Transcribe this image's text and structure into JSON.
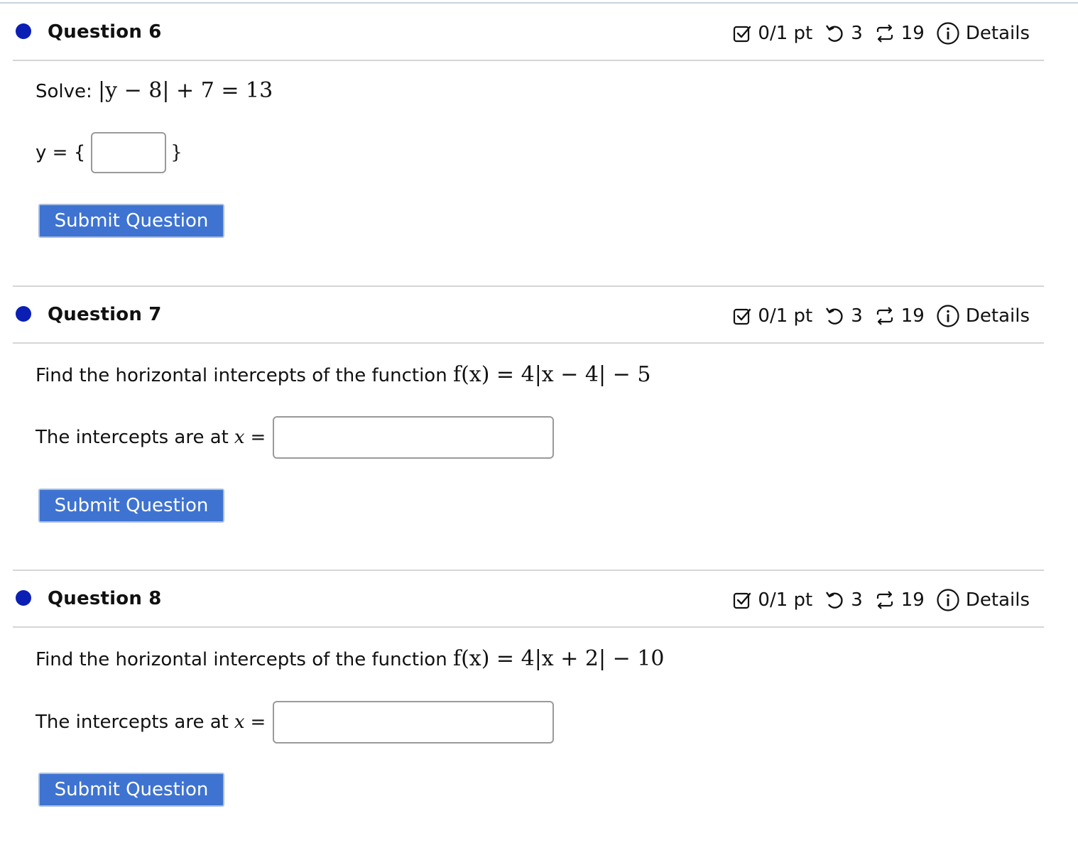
{
  "questions": [
    {
      "title": "Question 6",
      "score": "0/1 pt",
      "retries": "3",
      "attempts": "19",
      "details_label": "Details",
      "prompt_label": "Solve:",
      "prompt_math": "|y − 8| + 7 = 13",
      "answer_prefix": "y = {",
      "answer_suffix": "}",
      "answer_value": "",
      "submit_label": "Submit Question"
    },
    {
      "title": "Question 7",
      "score": "0/1 pt",
      "retries": "3",
      "attempts": "19",
      "details_label": "Details",
      "prompt_label": "Find the horizontal intercepts of the function",
      "prompt_math": "f(x) = 4|x − 4| − 5",
      "answer_prefix": "The intercepts are at",
      "answer_var": "x",
      "answer_eq": "=",
      "answer_value": "",
      "submit_label": "Submit Question"
    },
    {
      "title": "Question 8",
      "score": "0/1 pt",
      "retries": "3",
      "attempts": "19",
      "details_label": "Details",
      "prompt_label": "Find the horizontal intercepts of the function",
      "prompt_math": "f(x) = 4|x + 2| − 10",
      "answer_prefix": "The intercepts are at",
      "answer_var": "x",
      "answer_eq": "=",
      "answer_value": "",
      "submit_label": "Submit Question"
    }
  ],
  "colors": {
    "status_dot": "#0b1fb4",
    "submit_bg": "#3e73d1",
    "divider": "#d5d5d5"
  },
  "icons": {
    "score": "check-square-icon",
    "retries": "undo-icon",
    "attempts": "repeat-icon",
    "details": "info-icon"
  }
}
